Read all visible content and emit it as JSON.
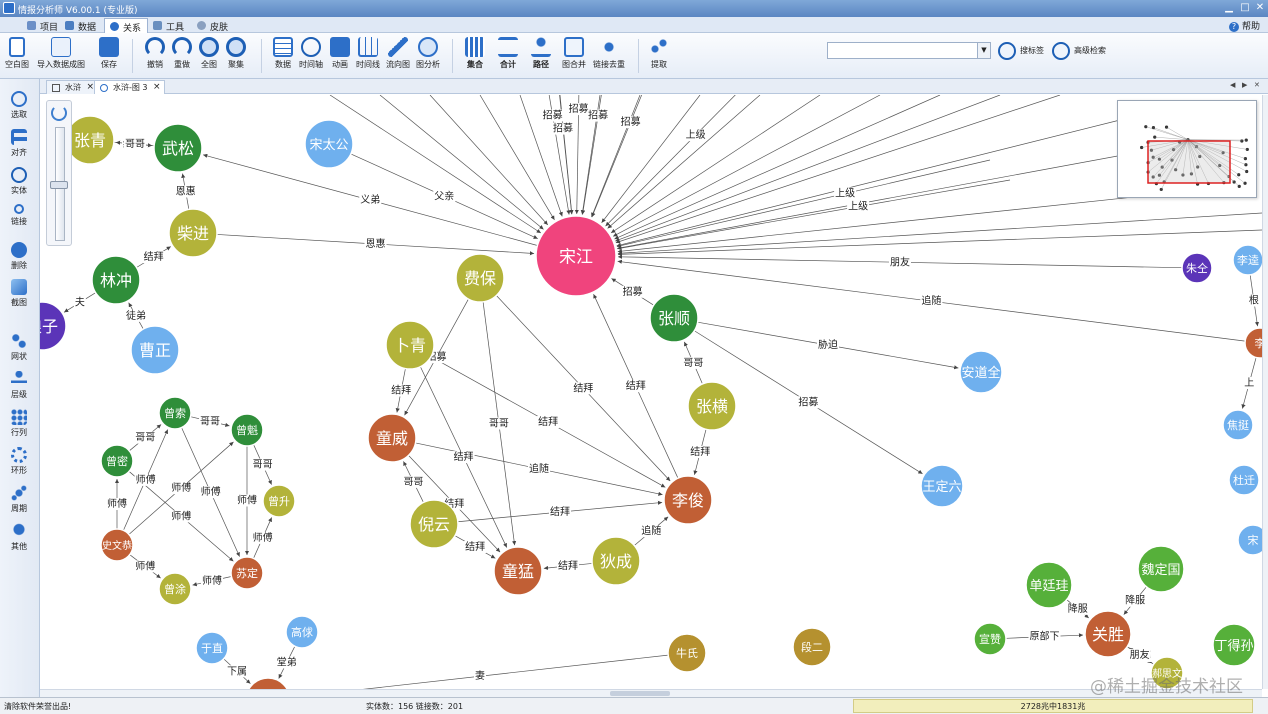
{
  "window": {
    "title": "情报分析师 V6.00.1 (专业版)",
    "min": "▁",
    "max": "□",
    "close": "✕"
  },
  "menu": {
    "tabs": [
      "项目",
      "数据",
      "关系",
      "工具",
      "皮肤"
    ],
    "active": 2,
    "help": "帮助"
  },
  "toolbar": {
    "buttons": [
      "空白图",
      "导入数据成图",
      "保存",
      "撤销",
      "重做",
      "全图",
      "聚集",
      "数据",
      "时间轴",
      "动画",
      "时间线",
      "流向图",
      "图分析",
      "集合",
      "合计",
      "路径",
      "图合并",
      "链接去重",
      "提取"
    ],
    "search_placeholder": "",
    "search_path": "搜标签",
    "advanced_search": "高级检索"
  },
  "doc_tabs": [
    "水浒",
    "水浒-图 3"
  ],
  "left_tools": [
    "选取",
    "对齐",
    "实体",
    "链接",
    "删除",
    "截图",
    "网状",
    "层级",
    "行列",
    "环形",
    "周期",
    "其他"
  ],
  "status": {
    "left": "清除软件荣誉出品!",
    "counts": "实体数：156    链接数：201",
    "scale": "2728兆中1831兆"
  },
  "watermark": "@稀土掘金技术社区",
  "graph": {
    "nodes": [
      {
        "id": "songjiang",
        "label": "宋江",
        "color": "#f0447d"
      },
      {
        "id": "wusong",
        "label": "武松",
        "color": "#2f8e3a"
      },
      {
        "id": "zhangqing",
        "label": "张青",
        "color": "#b3b33a"
      },
      {
        "id": "chaijin",
        "label": "柴进",
        "color": "#b3b33a"
      },
      {
        "id": "linchong",
        "label": "林冲",
        "color": "#2f8e3a"
      },
      {
        "id": "niangzi",
        "label": "娘子",
        "color": "#5b34b8"
      },
      {
        "id": "caozheng",
        "label": "曹正",
        "color": "#6fb0ee"
      },
      {
        "id": "songtaigong",
        "label": "宋太公",
        "color": "#6fb0ee"
      },
      {
        "id": "feibao",
        "label": "费保",
        "color": "#b3b33a"
      },
      {
        "id": "buqing",
        "label": "卜青",
        "color": "#b3b33a"
      },
      {
        "id": "tongwei",
        "label": "童威",
        "color": "#c15f35"
      },
      {
        "id": "niyun",
        "label": "倪云",
        "color": "#b3b33a"
      },
      {
        "id": "tongmeng",
        "label": "童猛",
        "color": "#c15f35"
      },
      {
        "id": "dicheng",
        "label": "狄成",
        "color": "#b3b33a"
      },
      {
        "id": "lijun",
        "label": "李俊",
        "color": "#c15f35"
      },
      {
        "id": "zhangshun",
        "label": "张顺",
        "color": "#2f8e3a"
      },
      {
        "id": "zhangheng",
        "label": "张横",
        "color": "#b3b33a"
      },
      {
        "id": "andaoquan",
        "label": "安道全",
        "color": "#6fb0ee"
      },
      {
        "id": "wangdingliu",
        "label": "王定六",
        "color": "#6fb0ee"
      },
      {
        "id": "zhuquan",
        "label": "朱仝",
        "color": "#5b34b8"
      },
      {
        "id": "likui",
        "label": "李逵",
        "color": "#6fb0ee"
      },
      {
        "id": "li",
        "label": "李",
        "color": "#c15f35"
      },
      {
        "id": "jiaoting",
        "label": "焦挺",
        "color": "#6fb0ee"
      },
      {
        "id": "duqian",
        "label": "杜迁",
        "color": "#6fb0ee"
      },
      {
        "id": "song",
        "label": "宋",
        "color": "#6fb0ee"
      },
      {
        "id": "zengsuo",
        "label": "曾索",
        "color": "#2f8e3a"
      },
      {
        "id": "zengkui",
        "label": "曾魁",
        "color": "#2f8e3a"
      },
      {
        "id": "zengmi",
        "label": "曾密",
        "color": "#2f8e3a"
      },
      {
        "id": "zengsheng",
        "label": "曾升",
        "color": "#b3b33a"
      },
      {
        "id": "shiwengong",
        "label": "史文恭",
        "color": "#c15f35"
      },
      {
        "id": "suding",
        "label": "苏定",
        "color": "#c15f35"
      },
      {
        "id": "zengtu",
        "label": "曾涂",
        "color": "#b3b33a"
      },
      {
        "id": "yuzhi",
        "label": "于直",
        "color": "#6fb0ee"
      },
      {
        "id": "gaolian",
        "label": "高俅",
        "color": "#6fb0ee"
      },
      {
        "id": "gaocolor",
        "label": "高",
        "color": "#c15f35"
      },
      {
        "id": "niushi",
        "label": "牛氏",
        "color": "#b5912f"
      },
      {
        "id": "duaner",
        "label": "段二",
        "color": "#b5912f"
      },
      {
        "id": "shantingui",
        "label": "单廷珪",
        "color": "#56b03a"
      },
      {
        "id": "weidingguo",
        "label": "魏定国",
        "color": "#56b03a"
      },
      {
        "id": "guansheng",
        "label": "关胜",
        "color": "#c15f35"
      },
      {
        "id": "xuanzan",
        "label": "宣赞",
        "color": "#56b03a"
      },
      {
        "id": "haosiwen",
        "label": "郝思文",
        "color": "#b3b33a"
      },
      {
        "id": "dingdesun",
        "label": "丁得孙",
        "color": "#56b03a"
      }
    ],
    "edge_labels": [
      "恩惠",
      "义弟",
      "父亲",
      "结拜",
      "哥哥",
      "恩惠",
      "结拜",
      "夫",
      "徒弟",
      "招募",
      "招募",
      "招募",
      "招募",
      "招募",
      "上级",
      "上级",
      "朋友",
      "追随",
      "招募",
      "哥哥",
      "胁迫",
      "招募",
      "结拜",
      "结拜",
      "招募",
      "结拜",
      "追随",
      "结拜",
      "结拜",
      "哥哥",
      "结拜",
      "结拜",
      "结拜",
      "追随",
      "结拜",
      "结拜",
      "哥哥",
      "师傅",
      "师傅",
      "师傅",
      "哥哥",
      "哥哥",
      "师傅",
      "师傅",
      "师傅",
      "师傅",
      "师傅",
      "下属",
      "堂弟",
      "妻",
      "哥哥",
      "降服",
      "降服",
      "原部下",
      "结拜",
      "朋友",
      "根",
      "哥哥",
      "上"
    ]
  }
}
